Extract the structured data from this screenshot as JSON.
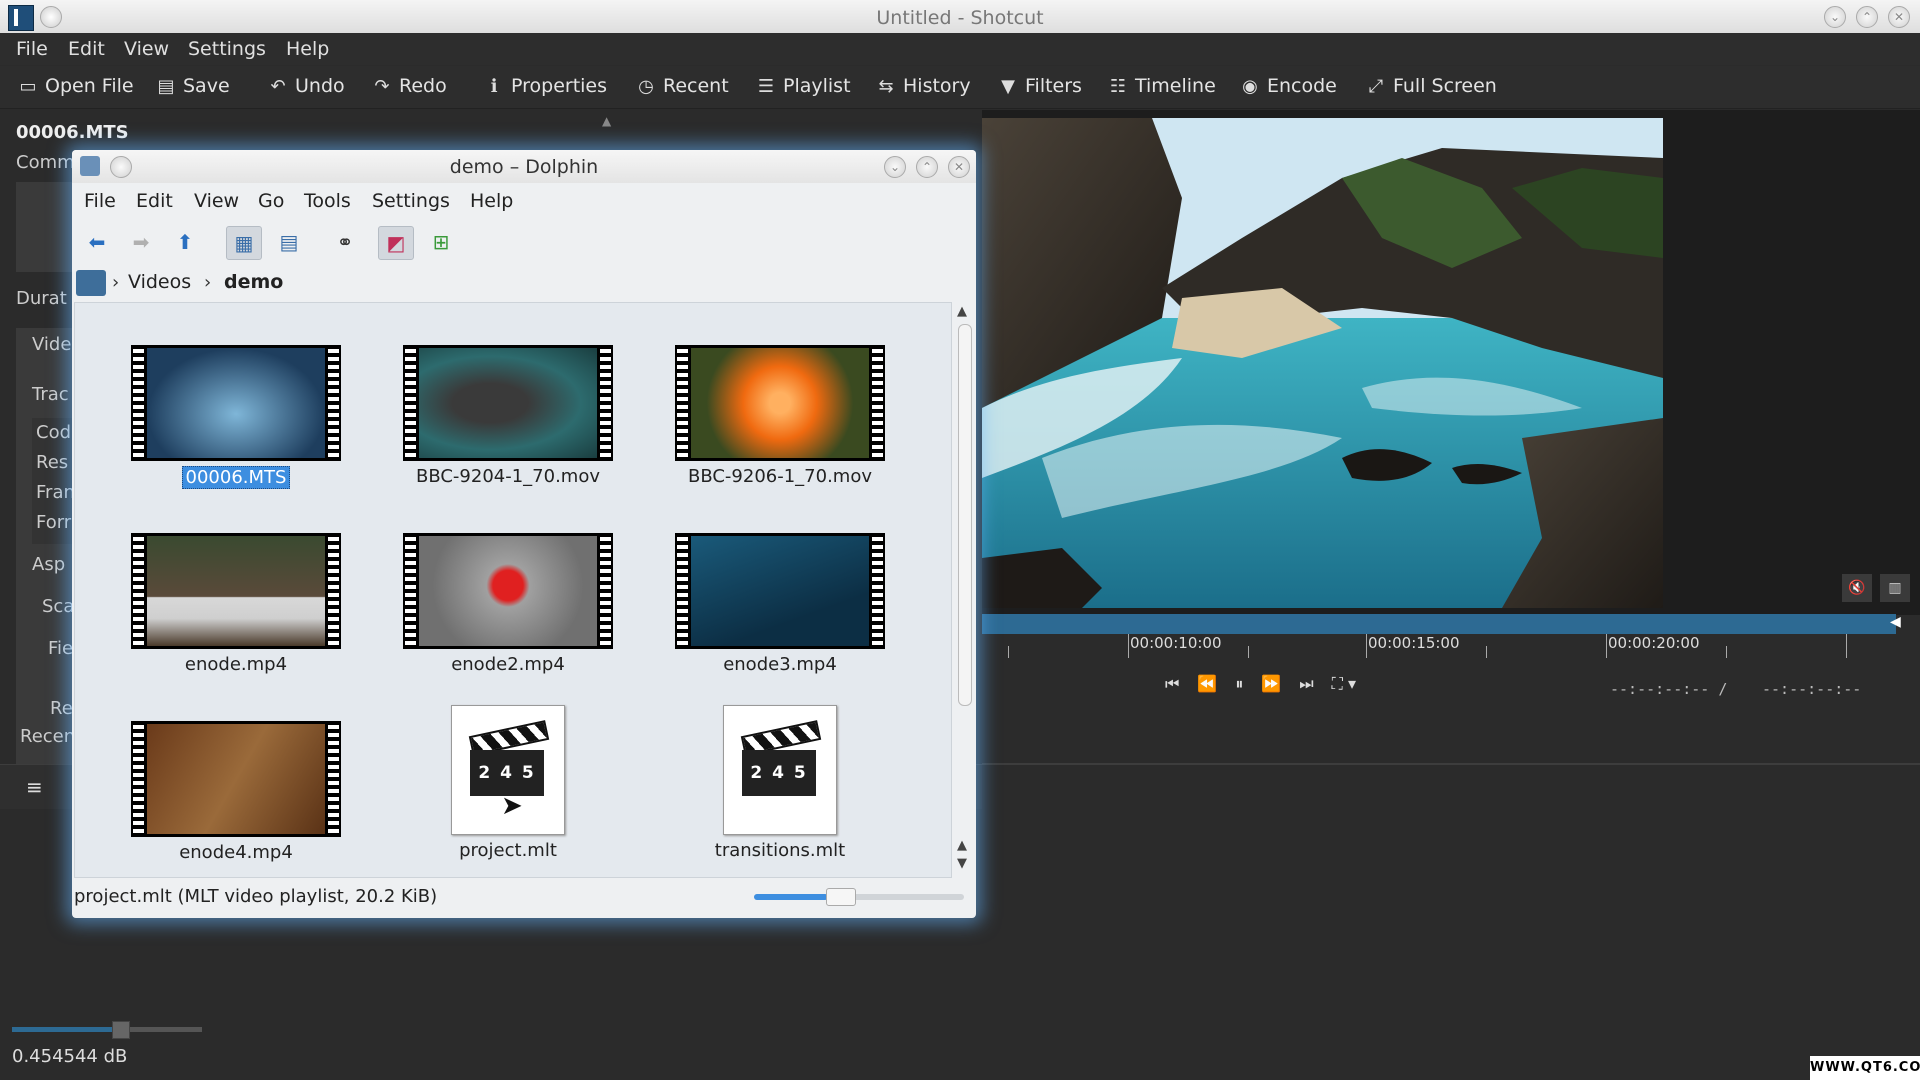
{
  "window": {
    "title": "Untitled - Shotcut"
  },
  "menu": [
    "File",
    "Edit",
    "View",
    "Settings",
    "Help"
  ],
  "toolbar": [
    {
      "label": "Open File",
      "icon": "open-file-icon",
      "glyph": "▭"
    },
    {
      "label": "Save",
      "icon": "save-icon",
      "glyph": "💾"
    },
    {
      "label": "Undo",
      "icon": "undo-icon",
      "glyph": "↶"
    },
    {
      "label": "Redo",
      "icon": "redo-icon",
      "glyph": "↷"
    },
    {
      "label": "Properties",
      "icon": "info-icon",
      "glyph": "ℹ"
    },
    {
      "label": "Recent",
      "icon": "clock-icon",
      "glyph": "◷"
    },
    {
      "label": "Playlist",
      "icon": "list-icon",
      "glyph": "☰"
    },
    {
      "label": "History",
      "icon": "history-icon",
      "glyph": "⇆"
    },
    {
      "label": "Filters",
      "icon": "filter-icon",
      "glyph": "▼"
    },
    {
      "label": "Timeline",
      "icon": "timeline-icon",
      "glyph": "☷"
    },
    {
      "label": "Encode",
      "icon": "encode-icon",
      "glyph": "◉"
    },
    {
      "label": "Full Screen",
      "icon": "fullscreen-icon",
      "glyph": "⤢"
    }
  ],
  "properties": {
    "filename": "00006.MTS",
    "labels": [
      "Comm",
      "Durat",
      "Vide",
      "Trac",
      "Cod",
      "Res",
      "Fran",
      "Forr",
      "Asp",
      "Sca",
      "Fie",
      "Re",
      "Recen"
    ]
  },
  "viewer": {
    "timecodes": [
      "00:00:10:00",
      "00:00:15:00",
      "00:00:20:00"
    ],
    "position": "--:--:--:-- /",
    "duration": "--:--:--:--"
  },
  "audio": {
    "level": "0.454544 dB"
  },
  "dolphin": {
    "title": "demo – Dolphin",
    "menu": [
      "File",
      "Edit",
      "View",
      "Go",
      "Tools",
      "Settings",
      "Help"
    ],
    "breadcrumb": [
      "Videos",
      "demo"
    ],
    "files": [
      {
        "name": "00006.MTS",
        "type": "video",
        "selected": true
      },
      {
        "name": "BBC-9204-1_70.mov",
        "type": "video",
        "selected": false
      },
      {
        "name": "BBC-9206-1_70.mov",
        "type": "video",
        "selected": false
      },
      {
        "name": "enode.mp4",
        "type": "video",
        "selected": false
      },
      {
        "name": "enode2.mp4",
        "type": "video",
        "selected": false
      },
      {
        "name": "enode3.mp4",
        "type": "video",
        "selected": false
      },
      {
        "name": "enode4.mp4",
        "type": "video",
        "selected": false
      },
      {
        "name": "project.mlt",
        "type": "mlt",
        "selected": false
      },
      {
        "name": "transitions.mlt",
        "type": "mlt",
        "selected": false
      }
    ],
    "status": "project.mlt (MLT video playlist, 20.2 KiB)",
    "clapper_text": "2 4 5"
  },
  "watermark": "WWW.QT6.COM"
}
